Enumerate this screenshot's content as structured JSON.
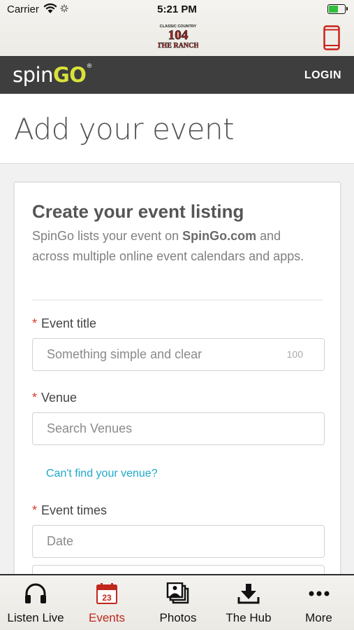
{
  "status_bar": {
    "carrier": "Carrier",
    "time": "5:21 PM"
  },
  "station": {
    "logo_small": "CLASSIC COUNTRY",
    "logo_number": "104",
    "logo_name": "THE RANCH"
  },
  "navbar": {
    "brand_spin": "spin",
    "brand_go": "GO",
    "brand_reg": "®",
    "login_label": "LOGIN"
  },
  "page": {
    "title": "Add your event"
  },
  "card": {
    "title": "Create your event listing",
    "desc_before": "SpinGo lists your event on ",
    "desc_bold": "SpinGo.com",
    "desc_after": " and across multiple online event calendars and apps."
  },
  "form": {
    "required_mark": "*",
    "event_title_label": "Event title",
    "event_title_placeholder": "Something simple and clear",
    "event_title_counter": "100",
    "venue_label": "Venue",
    "venue_placeholder": "Search Venues",
    "venue_link": "Can't find your venue?",
    "event_times_label": "Event times",
    "date_placeholder": "Date"
  },
  "tabs": [
    {
      "label": "Listen Live",
      "icon": "headphones-icon",
      "active": false
    },
    {
      "label": "Events",
      "icon": "calendar-icon",
      "active": true,
      "badge": "23"
    },
    {
      "label": "Photos",
      "icon": "photos-icon",
      "active": false
    },
    {
      "label": "The Hub",
      "icon": "download-icon",
      "active": false
    },
    {
      "label": "More",
      "icon": "more-icon",
      "active": false
    }
  ],
  "colors": {
    "accent_red": "#c0281d",
    "navbar_bg": "#3e3e3e",
    "brand_go": "#d9e23b",
    "link": "#1ea9c9",
    "battery": "#2fbf3b"
  }
}
